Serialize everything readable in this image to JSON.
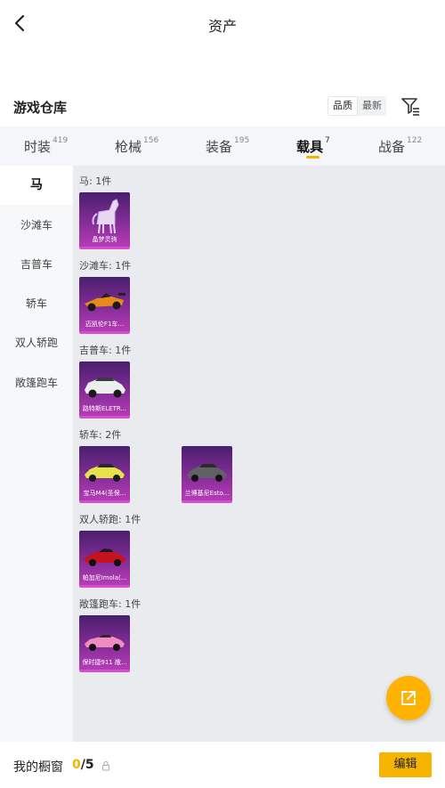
{
  "header": {
    "title": "资产"
  },
  "warehouse": {
    "title": "游戏仓库",
    "sort_quality": "品质",
    "sort_newest": "最新"
  },
  "tabs": [
    {
      "label": "时装",
      "count": "419"
    },
    {
      "label": "枪械",
      "count": "156"
    },
    {
      "label": "装备",
      "count": "195"
    },
    {
      "label": "载具",
      "count": "7",
      "active": true
    },
    {
      "label": "战备",
      "count": "122"
    }
  ],
  "sidebar": {
    "items": [
      {
        "label": "马",
        "active": true
      },
      {
        "label": "沙滩车"
      },
      {
        "label": "吉普车"
      },
      {
        "label": "轿车"
      },
      {
        "label": "双人轿跑"
      },
      {
        "label": "敞篷跑车"
      }
    ]
  },
  "groups": [
    {
      "label": "马: 1件",
      "items": [
        {
          "name": "晶梦灵驹",
          "icon": "horse-icon"
        }
      ]
    },
    {
      "label": "沙滩车: 1件",
      "items": [
        {
          "name": "迈凯伦F1车...",
          "icon": "f1-car-icon"
        }
      ]
    },
    {
      "label": "吉普车: 1件",
      "items": [
        {
          "name": "路特斯ELETR...",
          "icon": "suv-icon"
        }
      ]
    },
    {
      "label": "轿车: 2件",
      "items": [
        {
          "name": "宝马M4(圣保...",
          "icon": "sedan-yellow-icon"
        },
        {
          "name": "兰博基尼Esto...",
          "icon": "sedan-grey-icon"
        }
      ]
    },
    {
      "label": "双人轿跑: 1件",
      "items": [
        {
          "name": "帕加尼Imola(...",
          "icon": "coupe-red-icon"
        }
      ]
    },
    {
      "label": "敞篷跑车: 1件",
      "items": [
        {
          "name": "保时捷911 敞...",
          "icon": "convertible-pink-icon"
        }
      ]
    }
  ],
  "showcase": {
    "label": "我的橱窗",
    "current": "0",
    "total": "/5",
    "edit_label": "编辑"
  },
  "colors": {
    "accent": "#f5b400",
    "card_top": "#4a1f6e",
    "card_bottom": "#b53bb6"
  }
}
